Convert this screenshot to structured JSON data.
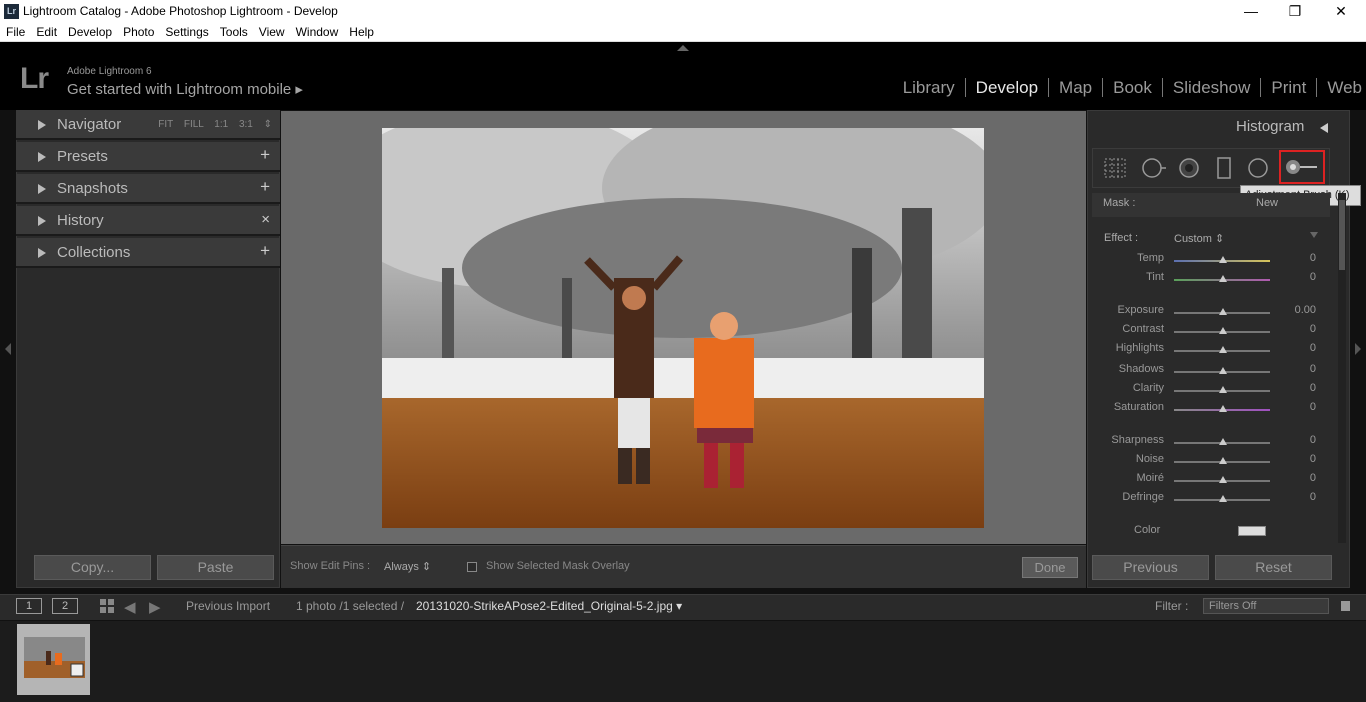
{
  "window": {
    "title": "Lightroom Catalog - Adobe Photoshop Lightroom - Develop",
    "app_icon": "Lr",
    "controls": [
      "—",
      "❐",
      "✕"
    ]
  },
  "menu": [
    "File",
    "Edit",
    "Develop",
    "Photo",
    "Settings",
    "Tools",
    "View",
    "Window",
    "Help"
  ],
  "identity": {
    "logo": "Lr",
    "product": "Adobe Lightroom 6",
    "mobile": "Get started with Lightroom mobile ▸"
  },
  "modules": [
    "Library",
    "Develop",
    "Map",
    "Book",
    "Slideshow",
    "Print",
    "Web"
  ],
  "left_panel": {
    "navigator": {
      "label": "Navigator",
      "zoom": "FIT FILL 1:1 3:1 ⇕"
    },
    "presets": {
      "label": "Presets",
      "action": "+"
    },
    "snapshots": {
      "label": "Snapshots",
      "action": "+"
    },
    "history": {
      "label": "History",
      "action": "×"
    },
    "collections": {
      "label": "Collections",
      "action": "+"
    },
    "copy": "Copy...",
    "paste": "Paste"
  },
  "toolbar": {
    "pins_label": "Show Edit Pins :",
    "pins_value": "Always ⇕",
    "mask_overlay": "Show Selected Mask Overlay",
    "done": "Done"
  },
  "right_panel": {
    "histogram": "Histogram",
    "tools": [
      "crop-overlay-icon",
      "spot-removal-icon",
      "red-eye-icon",
      "graduated-filter-icon",
      "radial-filter-icon",
      "adjustment-brush-icon"
    ],
    "tooltip": "Adjustment Brush (K)",
    "mask_label": "Mask :",
    "mask_new": "New",
    "effect_label": "Effect :",
    "effect_value": "Custom ⇕",
    "sliders": [
      {
        "label": "Temp",
        "value": "0"
      },
      {
        "label": "Tint",
        "value": "0"
      },
      {
        "label": "Exposure",
        "value": "0.00"
      },
      {
        "label": "Contrast",
        "value": "0"
      },
      {
        "label": "Highlights",
        "value": "0"
      },
      {
        "label": "Shadows",
        "value": "0"
      },
      {
        "label": "Clarity",
        "value": "0"
      },
      {
        "label": "Saturation",
        "value": "0"
      },
      {
        "label": "Sharpness",
        "value": "0"
      },
      {
        "label": "Noise",
        "value": "0"
      },
      {
        "label": "Moiré",
        "value": "0"
      },
      {
        "label": "Defringe",
        "value": "0"
      }
    ],
    "color_label": "Color",
    "previous": "Previous",
    "reset": "Reset"
  },
  "filmbar": {
    "view1": "1",
    "view2": "2",
    "source": "Previous Import",
    "count": "1 photo /1 selected /",
    "filename": "20131020-StrikeAPose2-Edited_Original-5-2.jpg ▾",
    "filter_label": "Filter :",
    "filter_value": "Filters Off"
  },
  "colors": {
    "accent_red": "#d22222",
    "panel": "#2a2a2a",
    "background": "#111111"
  }
}
